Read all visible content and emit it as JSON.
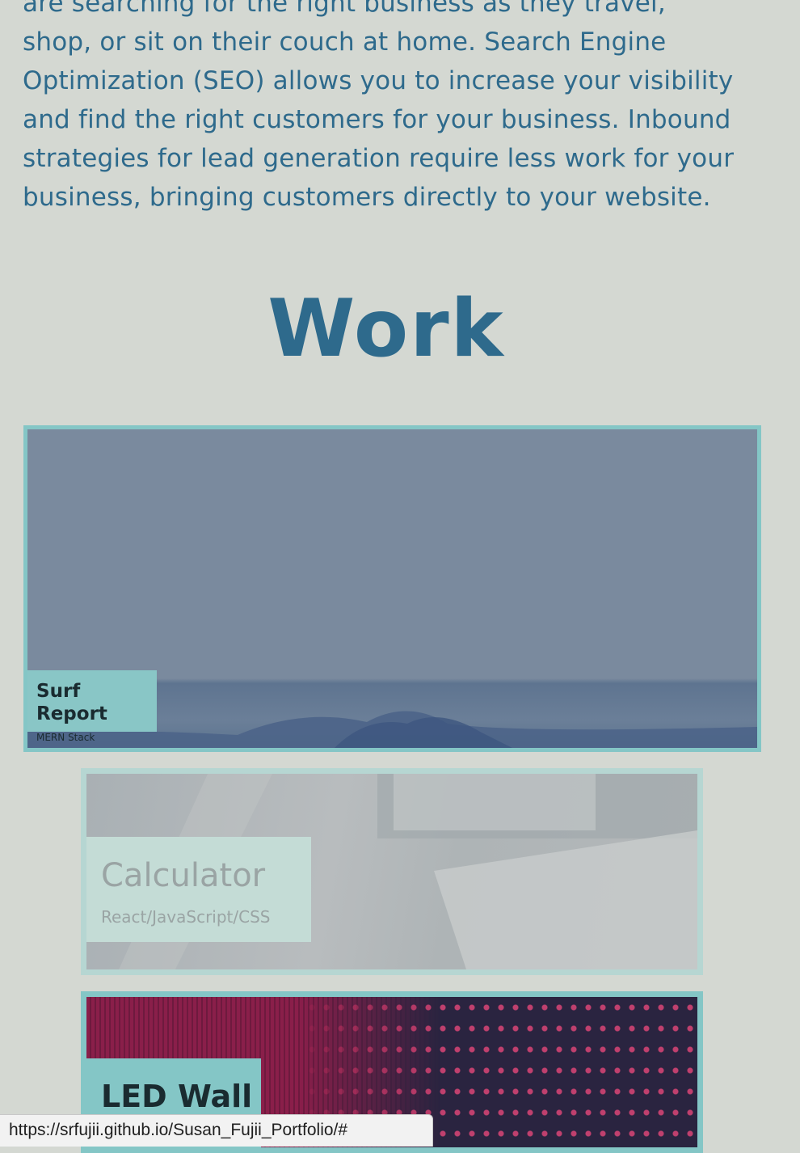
{
  "about": {
    "paragraph_lines": [
      "are searching for the right business as they travel,",
      "shop, or sit on their couch at home. Search Engine",
      "Optimization (SEO) allows you to increase your visibility",
      "and find the right customers for your business. Inbound",
      "strategies for lead generation require less work for your",
      "business, bringing customers directly to your website."
    ]
  },
  "work": {
    "title": "Work",
    "projects": [
      {
        "title": "Surf Report",
        "subtitle": "MERN Stack"
      },
      {
        "title": "Calculator",
        "subtitle": "React/JavaScript/CSS"
      },
      {
        "title": "LED Wall",
        "subtitle": ""
      }
    ]
  },
  "status_bar": {
    "url": "https://srfujii.github.io/Susan_Fujii_Portfolio/#"
  },
  "colors": {
    "background": "#d4d8d2",
    "text_accent": "#2e6a8c",
    "card_border": "#84c6c6"
  }
}
